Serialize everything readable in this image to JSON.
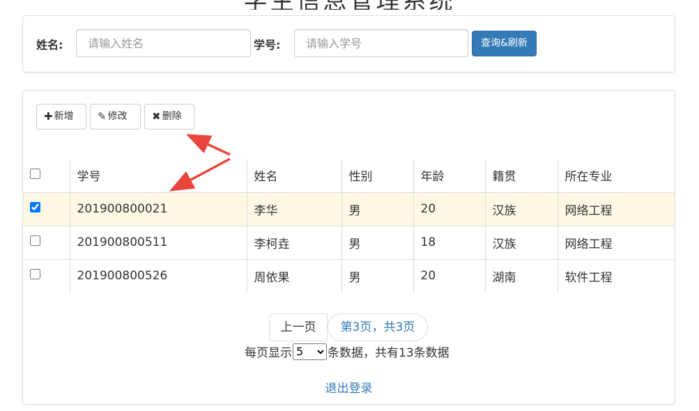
{
  "page": {
    "title": "学生信息管理系统"
  },
  "search": {
    "name_label": "姓名:",
    "name_placeholder": "请输入姓名",
    "name_value": "",
    "id_label": "学号:",
    "id_placeholder": "请输入学号",
    "id_value": "",
    "query_button": "查询&刷新"
  },
  "toolbar": {
    "add": {
      "icon": "plus-icon",
      "glyph": "✚",
      "label": "新增"
    },
    "edit": {
      "icon": "pencil-icon",
      "glyph": "✎",
      "label": "修改"
    },
    "delete": {
      "icon": "remove-icon",
      "glyph": "✖",
      "label": "删除"
    }
  },
  "table": {
    "headers": [
      "学号",
      "姓名",
      "性别",
      "年龄",
      "籍贯",
      "所在专业"
    ],
    "rows": [
      {
        "checked": true,
        "cells": [
          "201900800021",
          "李华",
          "男",
          "20",
          "汉族",
          "网络工程"
        ]
      },
      {
        "checked": false,
        "cells": [
          "201900800511",
          "李柯垚",
          "男",
          "18",
          "汉族",
          "网络工程"
        ]
      },
      {
        "checked": false,
        "cells": [
          "201900800526",
          "周依果",
          "男",
          "20",
          "湖南",
          "软件工程"
        ]
      }
    ]
  },
  "pagination": {
    "prev_label": "上一页",
    "page_info": "第3页，共3页",
    "per_page_prefix": "每页显示",
    "per_page_value": "5",
    "per_page_suffix": "条数据，共有13条数据"
  },
  "logout": "退出登录",
  "colors": {
    "primary": "#337ab7",
    "selected_row": "#fcf8e3",
    "annotation_arrow": "#e8453c",
    "border": "#dddddd"
  }
}
